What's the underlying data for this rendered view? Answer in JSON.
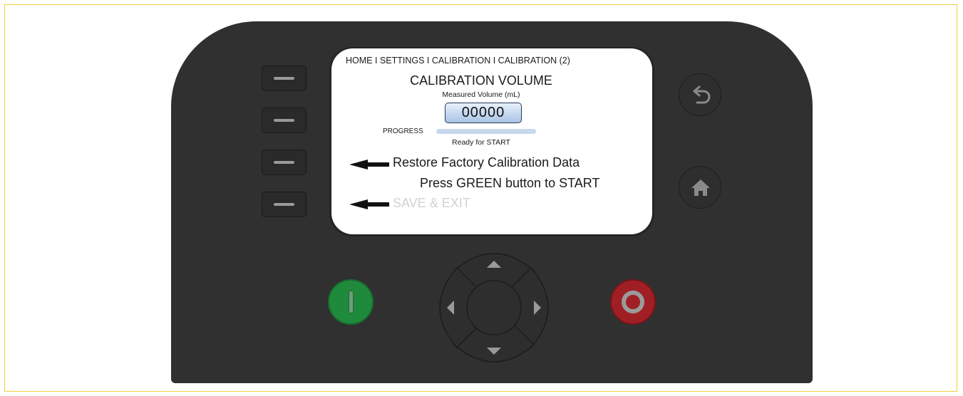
{
  "screen": {
    "breadcrumb": "HOME I SETTINGS I CALIBRATION I CALIBRATION (2)",
    "title": "CALIBRATION VOLUME",
    "measured_label": "Measured Volume (mL)",
    "measured_value": "00000",
    "progress_label": "PROGRESS",
    "progress_fraction": 0.0,
    "status": "Ready for START",
    "restore_label": "Restore Factory Calibration Data",
    "instruction": "Press GREEN button to START",
    "save_exit_label": "SAVE & EXIT"
  },
  "icons": {
    "back": "undo-arrow-icon",
    "home": "home-icon",
    "start": "start-icon",
    "stop": "stop-icon",
    "up": "arrow-up-icon",
    "down": "arrow-down-icon",
    "left": "arrow-left-icon",
    "right": "arrow-right-icon"
  },
  "colors": {
    "device_body": "#303030",
    "start_button": "#1f8a3b",
    "stop_button": "#a01f24",
    "value_box": "#a9c4e6",
    "progress_track": "#c7d8ec",
    "disabled_text": "#d2d2d2",
    "frame_border": "#f2cf3a"
  }
}
